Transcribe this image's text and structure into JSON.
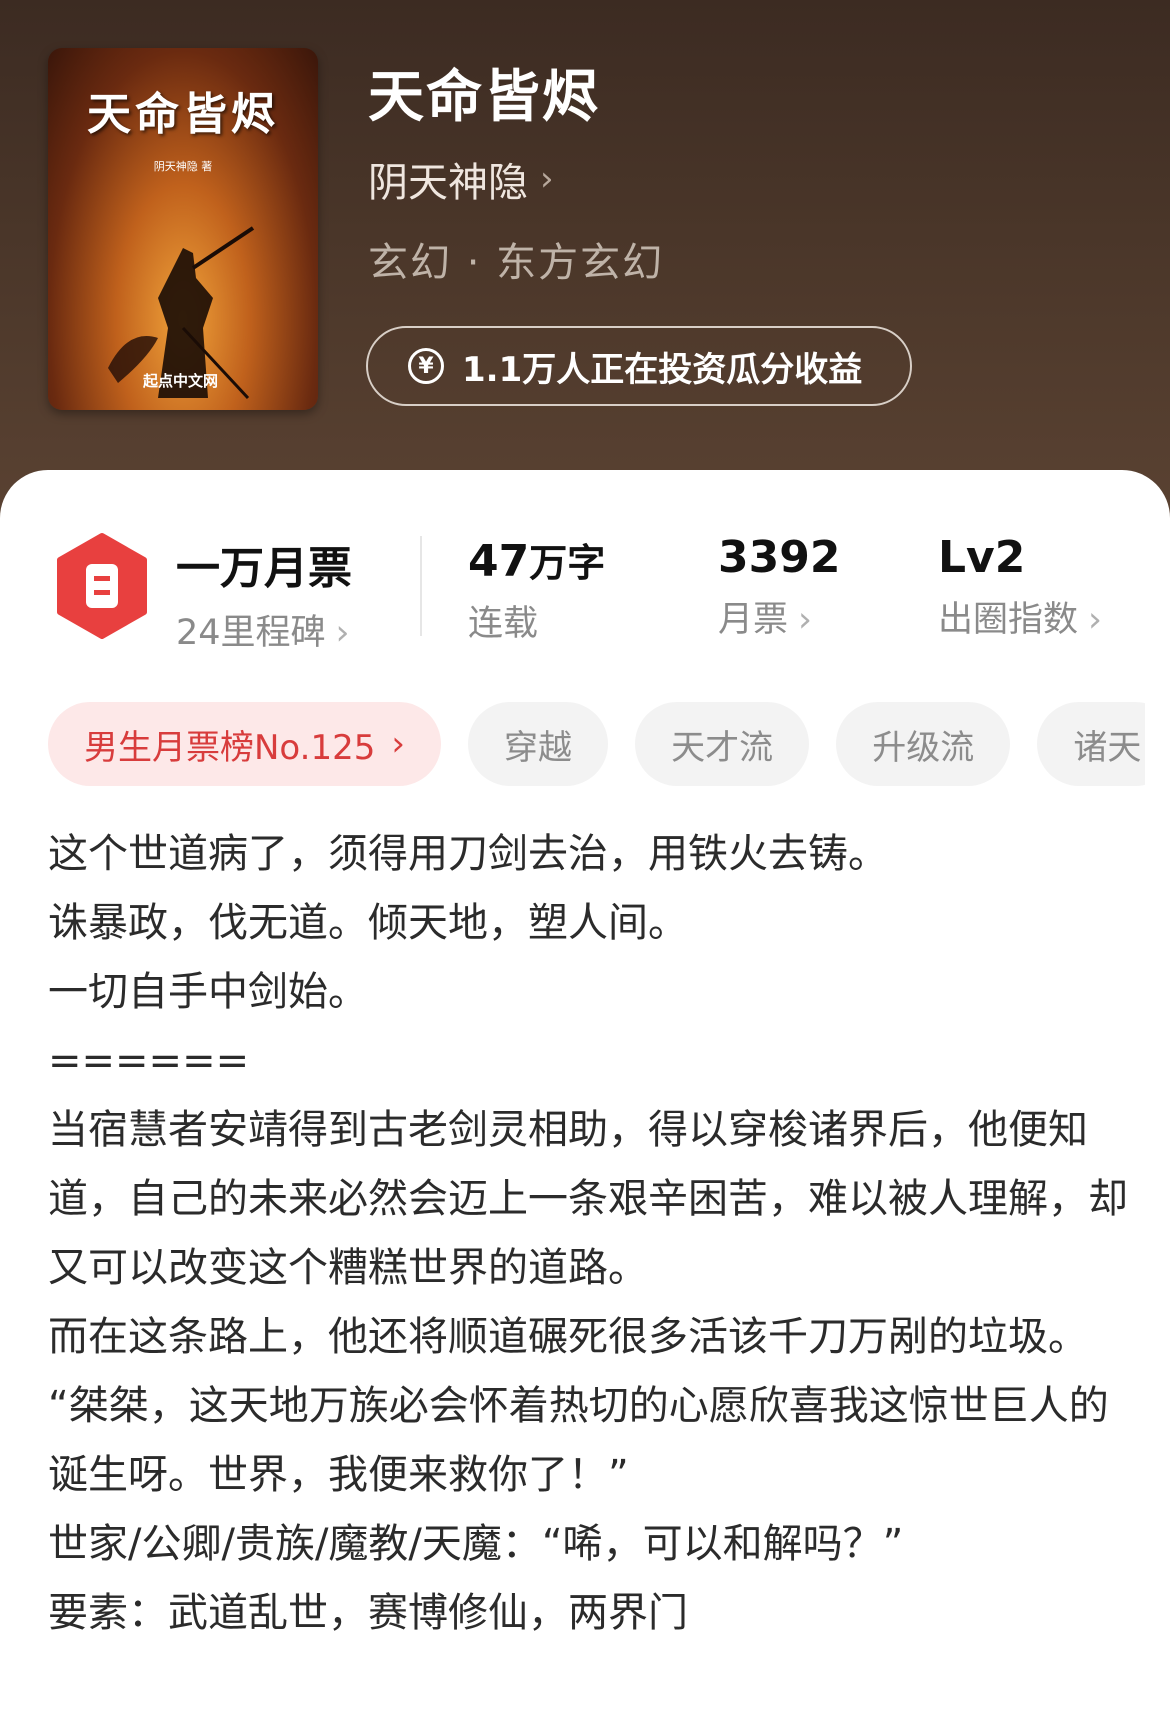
{
  "book": {
    "cover_title": "天命皆烬",
    "cover_author": "阴天神隐 著",
    "cover_publisher": "起点中文网",
    "title": "天命皆烬",
    "author": "阴天神隐",
    "author_chevron": "›",
    "genre": "玄幻 · 东方玄幻",
    "invest_icon": "yen-icon",
    "invest_label": "1.1万人正在投资瓜分收益"
  },
  "stats": {
    "milestone": {
      "value": "一万月票",
      "label": "24里程碑",
      "chevron": "›",
      "icon": "hexagon-badge-icon",
      "icon_color": "#e8403f"
    },
    "words": {
      "value": "47",
      "unit": "万字",
      "label": "连载"
    },
    "monthly_votes": {
      "value": "3392",
      "label": "月票",
      "chevron": "›"
    },
    "level": {
      "value": "Lv2",
      "label": "出圈指数",
      "chevron": "›"
    }
  },
  "tags": [
    {
      "label": "男生月票榜No.125",
      "chevron": "›"
    },
    {
      "label": "穿越"
    },
    {
      "label": "天才流"
    },
    {
      "label": "升级流"
    },
    {
      "label": "诸天"
    }
  ],
  "description": [
    "这个世道病了，须得用刀剑去治，用铁火去铸。",
    "诛暴政，伐无道。倾天地，塑人间。",
    "一切自手中剑始。",
    "======",
    "当宿慧者安靖得到古老剑灵相助，得以穿梭诸界后，他便知道，自己的未来必然会迈上一条艰辛困苦，难以被人理解，却又可以改变这个糟糕世界的道路。",
    "而在这条路上，他还将顺道碾死很多活该千刀万剐的垃圾。",
    "“桀桀，这天地万族必会怀着热切的心愿欣喜我这惊世巨人的诞生呀。世界，我便来救你了！”",
    "世家/公卿/贵族/魔教/天魔：“唏，可以和解吗？”",
    "要素：武道乱世，赛博修仙，两界门"
  ],
  "colors": {
    "header_bg": "#4a3629",
    "accent_red": "#e8403f",
    "rank_tag_bg": "#fde8e8",
    "tag_bg": "#f3f3f3"
  }
}
